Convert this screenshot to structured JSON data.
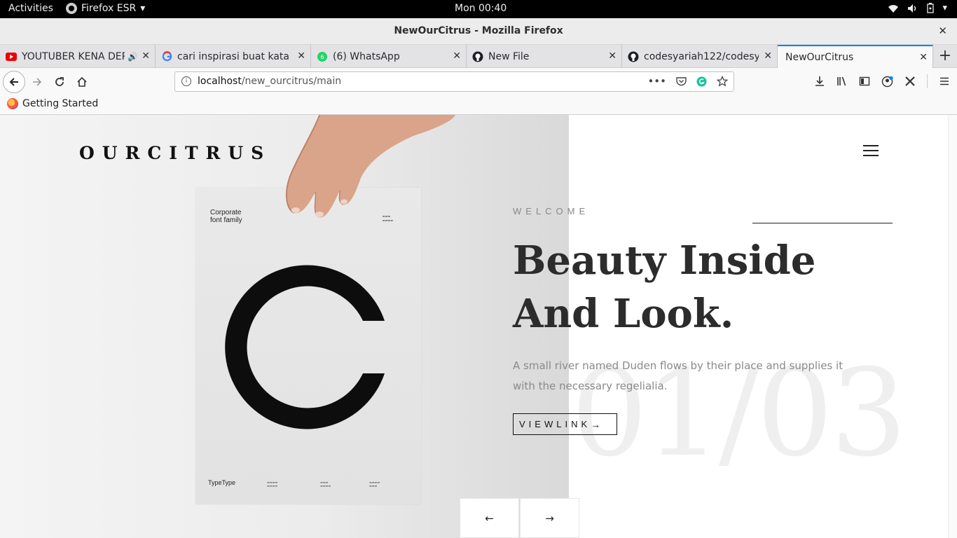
{
  "system_bar": {
    "activities": "Activities",
    "app_name": "Firefox ESR",
    "clock": "Mon 00:40"
  },
  "window": {
    "title": "NewOurCitrus - Mozilla Firefox"
  },
  "tabs": [
    {
      "label": "YOUTUBER KENA DEP",
      "favicon": "youtube-icon",
      "audio": true
    },
    {
      "label": "cari inspirasi buat kata kat",
      "favicon": "google-icon"
    },
    {
      "label": "(6) WhatsApp",
      "favicon": "whatsapp-icon"
    },
    {
      "label": "New File",
      "favicon": "github-icon"
    },
    {
      "label": "codesyariah122/codesyar",
      "favicon": "github-icon"
    },
    {
      "label": "NewOurCitrus",
      "favicon": "none",
      "active": true
    }
  ],
  "navbar": {
    "url_host": "localhost",
    "url_path": "/new_ourcitrus/main"
  },
  "bookmarks": [
    {
      "label": "Getting Started"
    }
  ],
  "site": {
    "logo": "OURCITRUS",
    "welcome": "WELCOME",
    "headline_line1": "Beauty Inside",
    "headline_line2": "And Look.",
    "description": "A small river named Duden flows by their place and supplies it with the necessary regelialia.",
    "button_label": "VIEWLINK",
    "button_arrow": "→",
    "slide_counter": "01/03",
    "prev_arrow": "←",
    "next_arrow": "→",
    "poster": {
      "title_line1": "Corporate",
      "title_line2": "font family",
      "brand": "TypeType"
    }
  },
  "colors": {
    "accent": "#0a84ff",
    "headline": "#2c2c2c",
    "body_text": "#8a8a8a"
  }
}
